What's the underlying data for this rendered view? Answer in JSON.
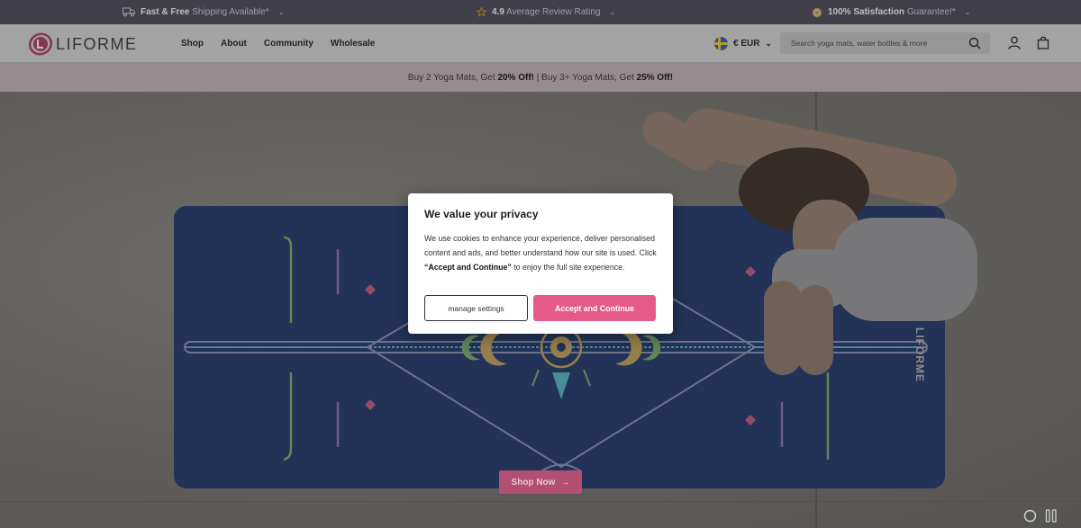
{
  "topbar": {
    "shipping_bold": "Fast & Free",
    "shipping_rest": "Shipping Available*",
    "rating_bold": "4.9",
    "rating_rest": "Average Review Rating",
    "guarantee_bold": "100% Satisfaction",
    "guarantee_rest": "Guarantee!*"
  },
  "header": {
    "logo_text": "LIFORME",
    "nav": [
      "Shop",
      "About",
      "Community",
      "Wholesale"
    ],
    "currency": "€ EUR",
    "search_placeholder": "Search yoga mats, water bottles & more"
  },
  "promo": {
    "part1": "Buy 2 Yoga Mats, Get ",
    "bold1": "20% Off!",
    "part2": " | Buy 3+ Yoga Mats, Get ",
    "bold2": "25% Off!"
  },
  "hero": {
    "mat_brand": "LIFORME",
    "cta_label": "Shop Now"
  },
  "cookie_modal": {
    "title": "We value your privacy",
    "text_before": "We use cookies to enhance your experience, deliver personalised content and ads, and better understand how our site is used. Click ",
    "text_bold": "“Accept and Continue”",
    "text_after": " to enjoy the full site experience.",
    "manage_label": "manage settings",
    "accept_label": "Accept and Continue"
  },
  "colors": {
    "accent_pink": "#e45b8a",
    "topbar_bg": "#4d4a5a",
    "mat_blue": "#20386c"
  }
}
